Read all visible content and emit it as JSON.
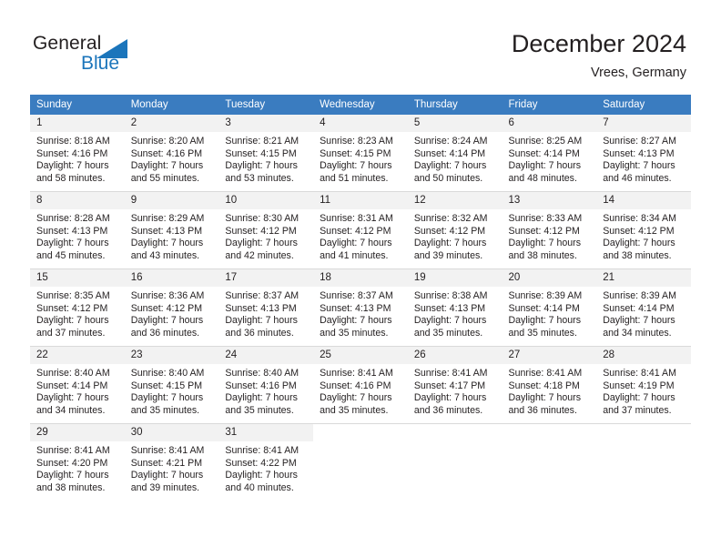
{
  "brand": {
    "name_part1": "General",
    "name_part2": "Blue",
    "mark": "triangle-logo-icon",
    "color_dark": "#231f20",
    "color_blue": "#1b75bb"
  },
  "header": {
    "title": "December 2024",
    "subtitle": "Vrees, Germany"
  },
  "theme": {
    "header_bg": "#3a7cc0",
    "header_text": "#ffffff",
    "daynum_bg": "#f2f2f2",
    "grid_line": "#d9d9d9",
    "body_text": "#231f20"
  },
  "weekdays": [
    "Sunday",
    "Monday",
    "Tuesday",
    "Wednesday",
    "Thursday",
    "Friday",
    "Saturday"
  ],
  "weeks": [
    [
      {
        "day": "1",
        "sunrise": "Sunrise: 8:18 AM",
        "sunset": "Sunset: 4:16 PM",
        "daylight1": "Daylight: 7 hours",
        "daylight2": "and 58 minutes."
      },
      {
        "day": "2",
        "sunrise": "Sunrise: 8:20 AM",
        "sunset": "Sunset: 4:16 PM",
        "daylight1": "Daylight: 7 hours",
        "daylight2": "and 55 minutes."
      },
      {
        "day": "3",
        "sunrise": "Sunrise: 8:21 AM",
        "sunset": "Sunset: 4:15 PM",
        "daylight1": "Daylight: 7 hours",
        "daylight2": "and 53 minutes."
      },
      {
        "day": "4",
        "sunrise": "Sunrise: 8:23 AM",
        "sunset": "Sunset: 4:15 PM",
        "daylight1": "Daylight: 7 hours",
        "daylight2": "and 51 minutes."
      },
      {
        "day": "5",
        "sunrise": "Sunrise: 8:24 AM",
        "sunset": "Sunset: 4:14 PM",
        "daylight1": "Daylight: 7 hours",
        "daylight2": "and 50 minutes."
      },
      {
        "day": "6",
        "sunrise": "Sunrise: 8:25 AM",
        "sunset": "Sunset: 4:14 PM",
        "daylight1": "Daylight: 7 hours",
        "daylight2": "and 48 minutes."
      },
      {
        "day": "7",
        "sunrise": "Sunrise: 8:27 AM",
        "sunset": "Sunset: 4:13 PM",
        "daylight1": "Daylight: 7 hours",
        "daylight2": "and 46 minutes."
      }
    ],
    [
      {
        "day": "8",
        "sunrise": "Sunrise: 8:28 AM",
        "sunset": "Sunset: 4:13 PM",
        "daylight1": "Daylight: 7 hours",
        "daylight2": "and 45 minutes."
      },
      {
        "day": "9",
        "sunrise": "Sunrise: 8:29 AM",
        "sunset": "Sunset: 4:13 PM",
        "daylight1": "Daylight: 7 hours",
        "daylight2": "and 43 minutes."
      },
      {
        "day": "10",
        "sunrise": "Sunrise: 8:30 AM",
        "sunset": "Sunset: 4:12 PM",
        "daylight1": "Daylight: 7 hours",
        "daylight2": "and 42 minutes."
      },
      {
        "day": "11",
        "sunrise": "Sunrise: 8:31 AM",
        "sunset": "Sunset: 4:12 PM",
        "daylight1": "Daylight: 7 hours",
        "daylight2": "and 41 minutes."
      },
      {
        "day": "12",
        "sunrise": "Sunrise: 8:32 AM",
        "sunset": "Sunset: 4:12 PM",
        "daylight1": "Daylight: 7 hours",
        "daylight2": "and 39 minutes."
      },
      {
        "day": "13",
        "sunrise": "Sunrise: 8:33 AM",
        "sunset": "Sunset: 4:12 PM",
        "daylight1": "Daylight: 7 hours",
        "daylight2": "and 38 minutes."
      },
      {
        "day": "14",
        "sunrise": "Sunrise: 8:34 AM",
        "sunset": "Sunset: 4:12 PM",
        "daylight1": "Daylight: 7 hours",
        "daylight2": "and 38 minutes."
      }
    ],
    [
      {
        "day": "15",
        "sunrise": "Sunrise: 8:35 AM",
        "sunset": "Sunset: 4:12 PM",
        "daylight1": "Daylight: 7 hours",
        "daylight2": "and 37 minutes."
      },
      {
        "day": "16",
        "sunrise": "Sunrise: 8:36 AM",
        "sunset": "Sunset: 4:12 PM",
        "daylight1": "Daylight: 7 hours",
        "daylight2": "and 36 minutes."
      },
      {
        "day": "17",
        "sunrise": "Sunrise: 8:37 AM",
        "sunset": "Sunset: 4:13 PM",
        "daylight1": "Daylight: 7 hours",
        "daylight2": "and 36 minutes."
      },
      {
        "day": "18",
        "sunrise": "Sunrise: 8:37 AM",
        "sunset": "Sunset: 4:13 PM",
        "daylight1": "Daylight: 7 hours",
        "daylight2": "and 35 minutes."
      },
      {
        "day": "19",
        "sunrise": "Sunrise: 8:38 AM",
        "sunset": "Sunset: 4:13 PM",
        "daylight1": "Daylight: 7 hours",
        "daylight2": "and 35 minutes."
      },
      {
        "day": "20",
        "sunrise": "Sunrise: 8:39 AM",
        "sunset": "Sunset: 4:14 PM",
        "daylight1": "Daylight: 7 hours",
        "daylight2": "and 35 minutes."
      },
      {
        "day": "21",
        "sunrise": "Sunrise: 8:39 AM",
        "sunset": "Sunset: 4:14 PM",
        "daylight1": "Daylight: 7 hours",
        "daylight2": "and 34 minutes."
      }
    ],
    [
      {
        "day": "22",
        "sunrise": "Sunrise: 8:40 AM",
        "sunset": "Sunset: 4:14 PM",
        "daylight1": "Daylight: 7 hours",
        "daylight2": "and 34 minutes."
      },
      {
        "day": "23",
        "sunrise": "Sunrise: 8:40 AM",
        "sunset": "Sunset: 4:15 PM",
        "daylight1": "Daylight: 7 hours",
        "daylight2": "and 35 minutes."
      },
      {
        "day": "24",
        "sunrise": "Sunrise: 8:40 AM",
        "sunset": "Sunset: 4:16 PM",
        "daylight1": "Daylight: 7 hours",
        "daylight2": "and 35 minutes."
      },
      {
        "day": "25",
        "sunrise": "Sunrise: 8:41 AM",
        "sunset": "Sunset: 4:16 PM",
        "daylight1": "Daylight: 7 hours",
        "daylight2": "and 35 minutes."
      },
      {
        "day": "26",
        "sunrise": "Sunrise: 8:41 AM",
        "sunset": "Sunset: 4:17 PM",
        "daylight1": "Daylight: 7 hours",
        "daylight2": "and 36 minutes."
      },
      {
        "day": "27",
        "sunrise": "Sunrise: 8:41 AM",
        "sunset": "Sunset: 4:18 PM",
        "daylight1": "Daylight: 7 hours",
        "daylight2": "and 36 minutes."
      },
      {
        "day": "28",
        "sunrise": "Sunrise: 8:41 AM",
        "sunset": "Sunset: 4:19 PM",
        "daylight1": "Daylight: 7 hours",
        "daylight2": "and 37 minutes."
      }
    ],
    [
      {
        "day": "29",
        "sunrise": "Sunrise: 8:41 AM",
        "sunset": "Sunset: 4:20 PM",
        "daylight1": "Daylight: 7 hours",
        "daylight2": "and 38 minutes."
      },
      {
        "day": "30",
        "sunrise": "Sunrise: 8:41 AM",
        "sunset": "Sunset: 4:21 PM",
        "daylight1": "Daylight: 7 hours",
        "daylight2": "and 39 minutes."
      },
      {
        "day": "31",
        "sunrise": "Sunrise: 8:41 AM",
        "sunset": "Sunset: 4:22 PM",
        "daylight1": "Daylight: 7 hours",
        "daylight2": "and 40 minutes."
      },
      {
        "day": "",
        "sunrise": "",
        "sunset": "",
        "daylight1": "",
        "daylight2": ""
      },
      {
        "day": "",
        "sunrise": "",
        "sunset": "",
        "daylight1": "",
        "daylight2": ""
      },
      {
        "day": "",
        "sunrise": "",
        "sunset": "",
        "daylight1": "",
        "daylight2": ""
      },
      {
        "day": "",
        "sunrise": "",
        "sunset": "",
        "daylight1": "",
        "daylight2": ""
      }
    ]
  ]
}
